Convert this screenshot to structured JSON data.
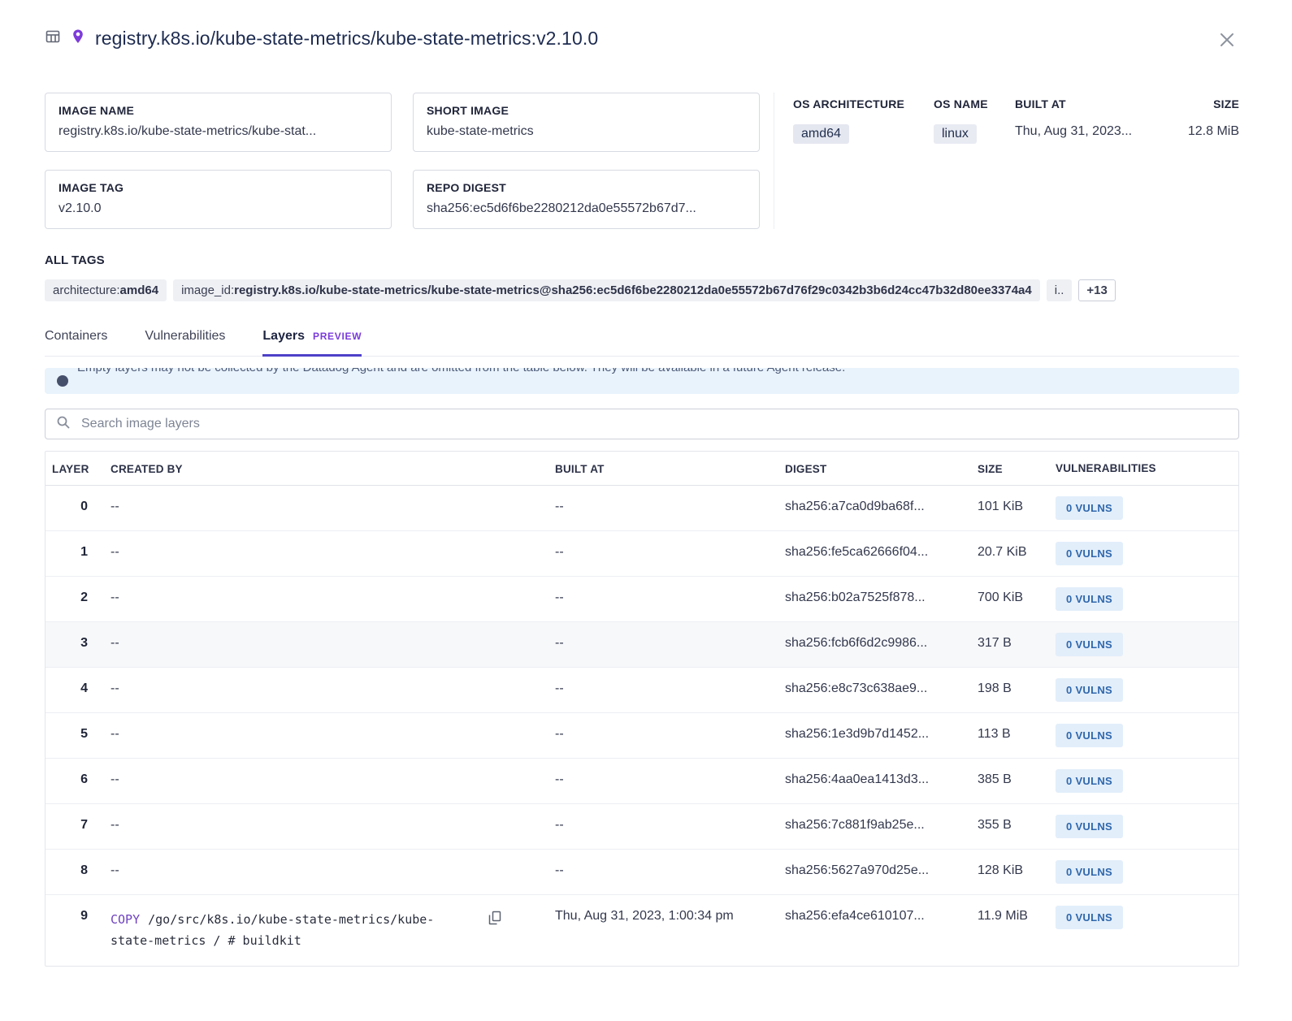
{
  "header": {
    "title": "registry.k8s.io/kube-state-metrics/kube-state-metrics:v2.10.0"
  },
  "fields": {
    "image_name": {
      "label": "IMAGE NAME",
      "value": "registry.k8s.io/kube-state-metrics/kube-stat..."
    },
    "short_image": {
      "label": "SHORT IMAGE",
      "value": "kube-state-metrics"
    },
    "image_tag": {
      "label": "IMAGE TAG",
      "value": "v2.10.0"
    },
    "repo_digest": {
      "label": "REPO DIGEST",
      "value": "sha256:ec5d6f6be2280212da0e55572b67d7..."
    }
  },
  "os_info": {
    "headers": [
      "OS ARCHITECTURE",
      "OS NAME",
      "BUILT AT",
      "SIZE"
    ],
    "architecture": "amd64",
    "name": "linux",
    "built_at": "Thu, Aug 31, 2023...",
    "size": "12.8 MiB"
  },
  "all_tags": {
    "label": "ALL TAGS",
    "tags": [
      {
        "key": "architecture:",
        "value": "amd64"
      },
      {
        "key": "image_id:",
        "value": "registry.k8s.io/kube-state-metrics/kube-state-metrics@sha256:ec5d6f6be2280212da0e55572b67d76f29c0342b3b6d24cc47b32d80ee3374a4"
      },
      {
        "key": "i..",
        "value": ""
      }
    ],
    "more_label": "+13"
  },
  "tabs": [
    {
      "label": "Containers"
    },
    {
      "label": "Vulnerabilities"
    },
    {
      "label": "Layers",
      "badge": "PREVIEW"
    }
  ],
  "banner": {
    "text": "Empty layers may not be collected by the Datadog Agent and are omitted from the table below. They will be available in a future Agent release."
  },
  "search": {
    "placeholder": "Search image layers"
  },
  "icons": {
    "grid-icon": "table-grid outline",
    "pin-icon": "purple location pin",
    "close-icon": "x",
    "info-icon": "filled info circle",
    "search-icon": "magnifier",
    "copy-icon": "duplicate squares"
  },
  "colors": {
    "accent_purple": "#7a3bdb",
    "tab_underline": "#4e40c9",
    "vulns_badge_bg": "#e2eefa",
    "vulns_badge_text": "#2f67ac",
    "banner_bg": "#e9f3fc"
  },
  "layers_table": {
    "headers": [
      "LAYER",
      "CREATED BY",
      "BUILT AT",
      "DIGEST",
      "SIZE",
      "VULNERABILITIES"
    ],
    "rows": [
      {
        "layer": "0",
        "created_by": "--",
        "built_at": "--",
        "digest": "sha256:a7ca0d9ba68f...",
        "size": "101 KiB",
        "vulns": "0 VULNS"
      },
      {
        "layer": "1",
        "created_by": "--",
        "built_at": "--",
        "digest": "sha256:fe5ca62666f04...",
        "size": "20.7 KiB",
        "vulns": "0 VULNS"
      },
      {
        "layer": "2",
        "created_by": "--",
        "built_at": "--",
        "digest": "sha256:b02a7525f878...",
        "size": "700 KiB",
        "vulns": "0 VULNS"
      },
      {
        "layer": "3",
        "created_by": "--",
        "built_at": "--",
        "digest": "sha256:fcb6f6d2c9986...",
        "size": "317 B",
        "vulns": "0 VULNS"
      },
      {
        "layer": "4",
        "created_by": "--",
        "built_at": "--",
        "digest": "sha256:e8c73c638ae9...",
        "size": "198 B",
        "vulns": "0 VULNS"
      },
      {
        "layer": "5",
        "created_by": "--",
        "built_at": "--",
        "digest": "sha256:1e3d9b7d1452...",
        "size": "113 B",
        "vulns": "0 VULNS"
      },
      {
        "layer": "6",
        "created_by": "--",
        "built_at": "--",
        "digest": "sha256:4aa0ea1413d3...",
        "size": "385 B",
        "vulns": "0 VULNS"
      },
      {
        "layer": "7",
        "created_by": "--",
        "built_at": "--",
        "digest": "sha256:7c881f9ab25e...",
        "size": "355 B",
        "vulns": "0 VULNS"
      },
      {
        "layer": "8",
        "created_by": "--",
        "built_at": "--",
        "digest": "sha256:5627a970d25e...",
        "size": "128 KiB",
        "vulns": "0 VULNS"
      },
      {
        "layer": "9",
        "created_by_cmd": "COPY",
        "created_by_path": "/go/src/k8s.io/kube-state-metrics/kube-state-metrics / # buildkit",
        "built_at": "Thu, Aug 31, 2023, 1:00:34 pm",
        "digest": "sha256:efa4ce610107...",
        "size": "11.9 MiB",
        "vulns": "0 VULNS"
      }
    ]
  }
}
